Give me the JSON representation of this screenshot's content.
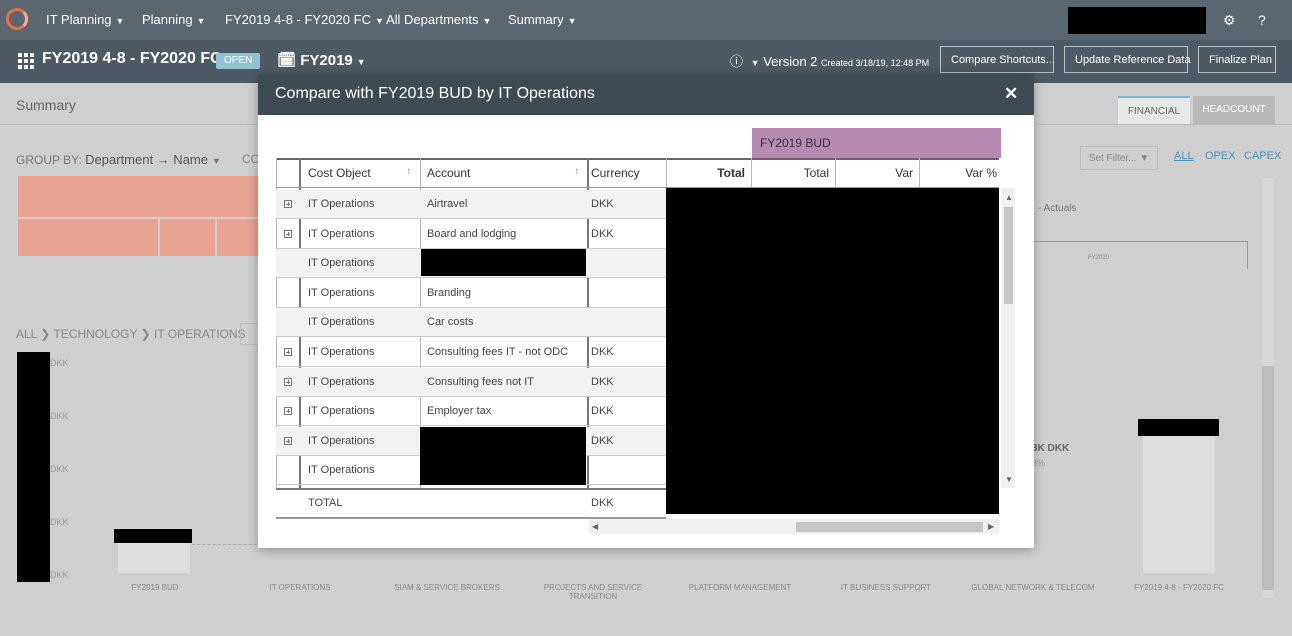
{
  "nav": {
    "items": [
      "IT Planning",
      "Planning",
      "FY2019 4-8 - FY2020 FC",
      "All Departments",
      "Summary"
    ],
    "settings_icon": "gear-icon",
    "help_icon": "help-icon"
  },
  "subbar": {
    "title": "FY2019 4-8 - FY2020 FC",
    "status_badge": "OPEN",
    "fiscal_year": "FY2019",
    "version_label": "Version 2",
    "version_created": "Created 3/18/19, 12:48 PM",
    "buttons": [
      "Compare Shortcuts...",
      "Update Reference Data",
      "Finalize Plan"
    ]
  },
  "background": {
    "page_title": "Summary",
    "tabs": [
      "FINANCIAL",
      "HEADCOUNT"
    ],
    "group_by_label": "GROUP BY:",
    "group_by_value": "Department → Name",
    "co_label": "CO",
    "set_filter": "Set Filter...",
    "filters": [
      "ALL",
      "OPEX",
      "CAPEX"
    ],
    "actuals_label": "- Actuals",
    "mini_axis_label": "FY2020",
    "breadcrumb": [
      "ALL",
      "TECHNOLOGY",
      "IT OPERATIONS"
    ],
    "axis_ticks": [
      "DKK",
      "DKK",
      "DKK",
      "DKK",
      "DKK"
    ],
    "partial_value": "3K DKK",
    "partial_pct": "3%",
    "categories": [
      "FY2019 BUD",
      "IT OPERATIONS",
      "SIAM & SERVICE BROKERS",
      "PROJECTS AND SERVICE TRANSITION",
      "PLATFORM MANAGEMENT",
      "IT BUSINESS SUPPORT",
      "GLOBAL NETWORK & TELECOM",
      "FY2019 4-8 - FY2020 FC"
    ]
  },
  "modal": {
    "title": "Compare with FY2019 BUD by IT Operations",
    "close_icon": "close-icon",
    "budget_group_label": "FY2019 BUD",
    "columns": [
      "Cost Object",
      "Account",
      "Currency",
      "Total",
      "Total",
      "Var",
      "Var %"
    ],
    "rows": [
      {
        "cost_object": "IT Operations",
        "account": "Airtravel",
        "currency": "DKK",
        "expandable": true
      },
      {
        "cost_object": "IT Operations",
        "account": "Board and lodging",
        "currency": "DKK",
        "expandable": true
      },
      {
        "cost_object": "IT Operations",
        "account": "",
        "currency": "",
        "expandable": false
      },
      {
        "cost_object": "IT Operations",
        "account": "Branding",
        "currency": "",
        "expandable": false
      },
      {
        "cost_object": "IT Operations",
        "account": "Car costs",
        "currency": "",
        "expandable": false
      },
      {
        "cost_object": "IT Operations",
        "account": "Consulting fees IT - not ODC",
        "currency": "DKK",
        "expandable": true
      },
      {
        "cost_object": "IT Operations",
        "account": "Consulting fees not IT",
        "currency": "DKK",
        "expandable": true
      },
      {
        "cost_object": "IT Operations",
        "account": "Employer tax",
        "currency": "DKK",
        "expandable": true
      },
      {
        "cost_object": "IT Operations",
        "account": "",
        "currency": "DKK",
        "expandable": true
      },
      {
        "cost_object": "IT Operations",
        "account": "",
        "currency": "",
        "expandable": false
      }
    ],
    "total_label": "TOTAL",
    "total_currency": "DKK"
  }
}
